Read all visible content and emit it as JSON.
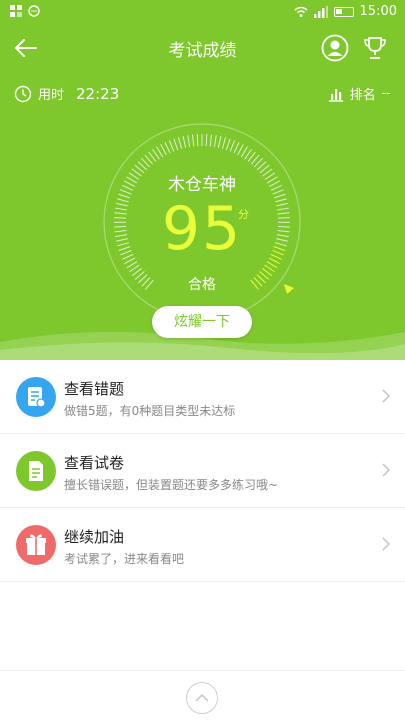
{
  "status_bar": {
    "time": "15:00"
  },
  "nav": {
    "title": "考试成绩"
  },
  "info": {
    "time_label": "用时",
    "time_value": "22:23",
    "rank_label": "排名",
    "rank_value": "--"
  },
  "result": {
    "name": "木仓车神",
    "score": "95",
    "unit": "分",
    "pass_text": "合格"
  },
  "share_button": "炫耀一下",
  "list": [
    {
      "title": "查看错题",
      "subtitle": "做错5题，有0种题目类型未达标",
      "color": "#35a5f0",
      "icon": "doc-edit-icon"
    },
    {
      "title": "查看试卷",
      "subtitle": "擅长错误题，但装置题还要多多练习哦~",
      "color": "#7ec82d",
      "icon": "doc-icon"
    },
    {
      "title": "继续加油",
      "subtitle": "考试累了，进来看看吧",
      "color": "#f06a6a",
      "icon": "gift-icon"
    }
  ],
  "colors": {
    "brand_green": "#7ec82d",
    "score_yellow": "#e8ff3a"
  }
}
